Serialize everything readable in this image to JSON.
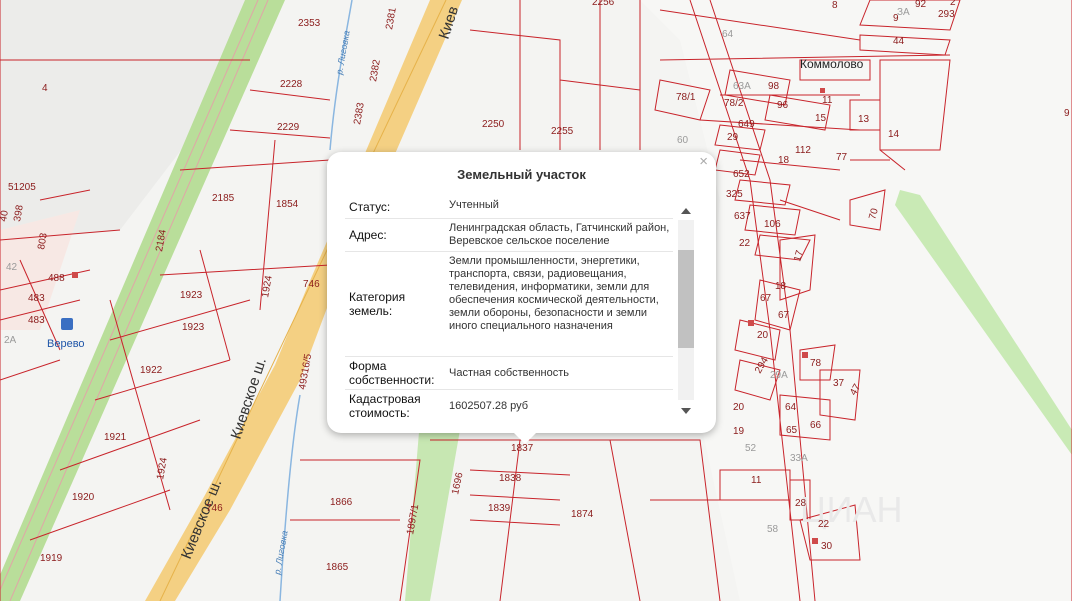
{
  "map": {
    "road_labels": [
      "Киевское ш.",
      "Киевское ш.",
      "Киев"
    ],
    "river_labels": [
      "р. Лиговка",
      "р. Лиговка"
    ],
    "places": {
      "verevo": "Верево",
      "kommolovo": "Коммолово"
    },
    "watermark": "ЦИАН",
    "plots": [
      "2353",
      "2381",
      "2382",
      "2383",
      "2228",
      "2229",
      "2250",
      "2255",
      "2256",
      "2185",
      "1854",
      "2184",
      "1923",
      "1923",
      "1924",
      "746",
      "1922",
      "1921",
      "1920",
      "1919",
      "1924",
      "746",
      "49316/5",
      "1866",
      "1865",
      "1897/1",
      "1696",
      "1837",
      "1838",
      "1839",
      "1874",
      "4",
      "51205",
      "398",
      "40",
      "803",
      "488",
      "483",
      "483",
      "2А",
      "42",
      "8",
      "9",
      "293",
      "44",
      "64",
      "63А",
      "78/1",
      "78/2",
      "98",
      "96",
      "15",
      "13",
      "14",
      "649",
      "112",
      "29",
      "18",
      "77",
      "60",
      "652",
      "325",
      "637",
      "106",
      "70",
      "22",
      "17",
      "18",
      "67",
      "67",
      "20",
      "294",
      "78",
      "29А",
      "37",
      "47",
      "20",
      "19",
      "64",
      "65",
      "66",
      "52",
      "33А",
      "11",
      "28",
      "22",
      "30",
      "58",
      "92",
      "11",
      "2",
      "ЗА",
      "9"
    ]
  },
  "popup": {
    "title": "Земельный участок",
    "close_label": "×",
    "rows": [
      {
        "key": "Статус:",
        "value": "Учтенный"
      },
      {
        "key": "Адрес:",
        "value": "Ленинградская область, Гатчинский район, Веревское сельское поселение"
      },
      {
        "key": "Категория земель:",
        "value": "Земли промышленности, энергетики, транспорта, связи, радиовещания, телевидения, информатики, земли для обеспечения космической деятельности, земли обороны, безопасности и земли иного специального назначения"
      },
      {
        "key": "Форма собственности:",
        "value": "Частная собственность"
      },
      {
        "key": "Кадастровая стоимость:",
        "value": "1602507.28 руб"
      }
    ]
  }
}
